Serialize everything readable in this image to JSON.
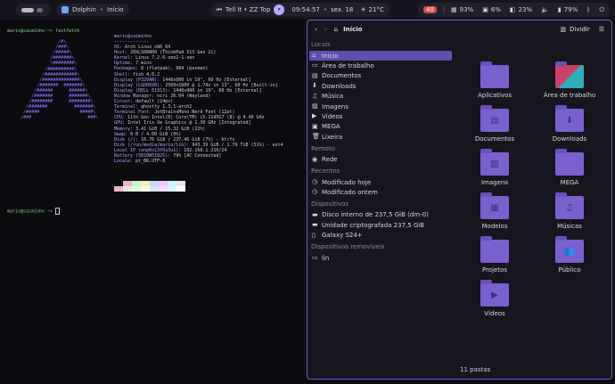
{
  "topbar": {
    "app_name": "Dolphin",
    "app_sub": "Início",
    "music": "Tell It • ZZ Top",
    "time": "09:54:57",
    "date": "sex. 18",
    "weather": "21°C",
    "notif": "40",
    "mem": "93%",
    "cpu": "6%",
    "disk": "23%",
    "battery": "79%"
  },
  "terminal": {
    "prompt1": "mario@saimínho ~> fastfetch",
    "prompt2": "mario@saimínho ~>",
    "user_host": "mario@saimínho",
    "sep": "-------------",
    "info": [
      {
        "k": "OS",
        "v": "Arch Linux x86_64"
      },
      {
        "k": "Host",
        "v": "20XLS06N00 (ThinkPad X13 Gen 2i)"
      },
      {
        "k": "Kernel",
        "v": "Linux 7.2.6-zen2-1-zen"
      },
      {
        "k": "Uptime",
        "v": "7 mins"
      },
      {
        "k": "Packages",
        "v": "8 (flatpak), 984 (pacman)"
      },
      {
        "k": "Shell",
        "v": "fish 4.0.2"
      },
      {
        "k": "Display (P32VAN)",
        "v": "1440x900 in 19\", 60 Hz [External]"
      },
      {
        "k": "Display (LGD0698)",
        "v": "2560x1600 @ 1.74x in 13\", 60 Hz [Built-in]"
      },
      {
        "k": "Display (DELL E1913)",
        "v": "1440x900 in 19\", 60 Hz [External]"
      },
      {
        "k": "Window Manager",
        "v": "niri 26.04 (Wayland)"
      },
      {
        "k": "Cursor",
        "v": "default (24px)"
      },
      {
        "k": "Terminal",
        "v": "ghostty 1.3.1-arch2"
      },
      {
        "k": "Terminal Font",
        "v": "JetBrainsMono Nerd Font (12pt)"
      },
      {
        "k": "CPU",
        "v": "11th Gen Intel(R) Core(TM) i5-1145G7 (8) @ 4.40 GHz"
      },
      {
        "k": "GPU",
        "v": "Intel Iris Xe Graphics @ 1.30 GHz [Integrated]"
      },
      {
        "k": "Memory",
        "v": "3.41 GiB / 15.32 GiB (22%)"
      },
      {
        "k": "Swap",
        "v": "0 B / 4.00 GiB (0%)"
      },
      {
        "k": "Disk (/)",
        "v": "16.76 GiB / 237.46 GiB (7%) - btrfs"
      },
      {
        "k": "Disk (/run/media/mario/lin)",
        "v": "943.39 GiB / 1.79 TiB (51%) - ext4"
      },
      {
        "k": "Local IP (enp0s13f0u3u1)",
        "v": "192.168.1.210/24"
      },
      {
        "k": "Battery (5B10W51825)",
        "v": "79% [AC Connected]"
      },
      {
        "k": "Locale",
        "v": "pt_BR.UTF-8"
      }
    ],
    "logo": "                  .\n                 /#\\\n                /###\\\n               /#####\\\n              /#######\\\n             _\\########\\\n            /##########\\\n           /############\\\n          /##############\\\n         /#######  #######\\\n        /######      ######\\\n       /#######      #######\\\n      /########      ########\\\n     /#######          #######\\\n    /#####               #####\\\n   /###                     ###\\"
  },
  "fm": {
    "crumb": "Início",
    "split": "Dividir",
    "sections": [
      {
        "title": "Locais",
        "items": [
          "Início",
          "Área de trabalho",
          "Documentos",
          "Downloads",
          "Música",
          "Imagens",
          "Vídeos",
          "MEGA",
          "Lixeira"
        ]
      },
      {
        "title": "Remoto",
        "items": [
          "Rede"
        ]
      },
      {
        "title": "Recentes",
        "items": [
          "Modificado hoje",
          "Modificado ontem"
        ]
      },
      {
        "title": "Dispositivos",
        "items": [
          "Disco interno de 237,5 GiB (dm-0)",
          "Unidade criptografada 237,5 GiB",
          "Galaxy S24+"
        ]
      },
      {
        "title": "Dispositivos removíveis",
        "items": [
          "lin"
        ]
      }
    ],
    "folders": [
      "Aplicativos",
      "Área de trabalho",
      "Documentos",
      "Downloads",
      "Imagens",
      "MEGA",
      "Modelos",
      "Músicas",
      "Projetos",
      "Público",
      "Vídeos"
    ],
    "status": "11 pastas",
    "colors": {
      "accent": "#7a5fcf",
      "selection": "#5b4fb0",
      "border": "#6a5fd1"
    }
  }
}
